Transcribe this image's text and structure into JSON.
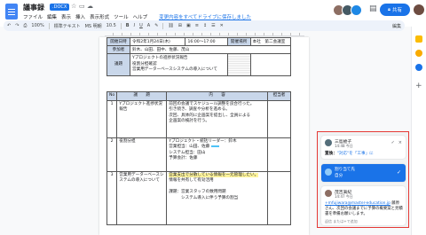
{
  "header": {
    "title": "議事録",
    "badge": ".DOCX",
    "menu": [
      "ファイル",
      "編集",
      "表示",
      "挿入",
      "表示形式",
      "ツール",
      "ヘルプ"
    ],
    "save_notice": "変更内容をすべてドライブに保存しました",
    "share_label": "共有"
  },
  "toolbar": {
    "zoom": "100%",
    "style": "標準テキスト",
    "font": "MS 明朝",
    "size": "10.5",
    "mode": "編集"
  },
  "table_top": {
    "date_label": "開催日時",
    "date_value": "令和2年1月24日(木)",
    "time_value": "16:00〜17:00",
    "place_label": "開催場所",
    "place_value": "本社　第二会議室",
    "attendees_label": "参加者",
    "attendees_value": "鈴木、山田、田中、佐藤、茂山",
    "agenda_label": "議題",
    "agenda_items": [
      "Yプロジェクトの進捗状況報告",
      "役割分担確認",
      "営業用データーベースシステムの導入について"
    ]
  },
  "table_main": {
    "headers": [
      "No",
      "議　　題",
      "内　　容",
      "担当者"
    ],
    "rows": [
      {
        "no": "1",
        "topic": "Yプロジェクト進捗状況報告",
        "lines": [
          "前回の会議でスケジュール調整を良合行った。",
          "引き続き、調査や分析を進める。",
          "次回、具体的に企画案を提出し、全員による",
          "企画案の検討を行う。"
        ],
        "owner": ""
      },
      {
        "no": "2",
        "topic": "役割分担",
        "lines": [
          "Yプロジェクト・統括リーダー：鈴木",
          "営業担当：山田、佐藤",
          "システム担当：田山",
          "予算会計：佐藤"
        ],
        "owner": ""
      },
      {
        "no": "3",
        "topic": "営業用データーベースシステムの導入について",
        "highlight": "営業支出で分散している情報を一元管理したい。",
        "lines": [
          "情報を共有して有効活用",
          "",
          "課題：営業スタッフの数用問題",
          "　　　システム導入に伴う予算の割当"
        ],
        "owner": ""
      }
    ]
  },
  "comments": {
    "c1": {
      "name": "三島絵子",
      "time": "14:48 今日",
      "label": "置換：",
      "text": "\"対応\"を「工事」に",
      "check": "✓",
      "close": "×"
    },
    "c2": {
      "who": "割り当て先",
      "what": "自分",
      "check": "✓"
    },
    "c3": {
      "name": "茂吉眞紀",
      "time": "14:47 今日",
      "mention": "+mfujiwara@master-education.jp",
      "text": "藤原さん、次回の会議までに予算の概要案と見積書を準備お願いします。",
      "reply": "返信 または+で追加"
    }
  }
}
